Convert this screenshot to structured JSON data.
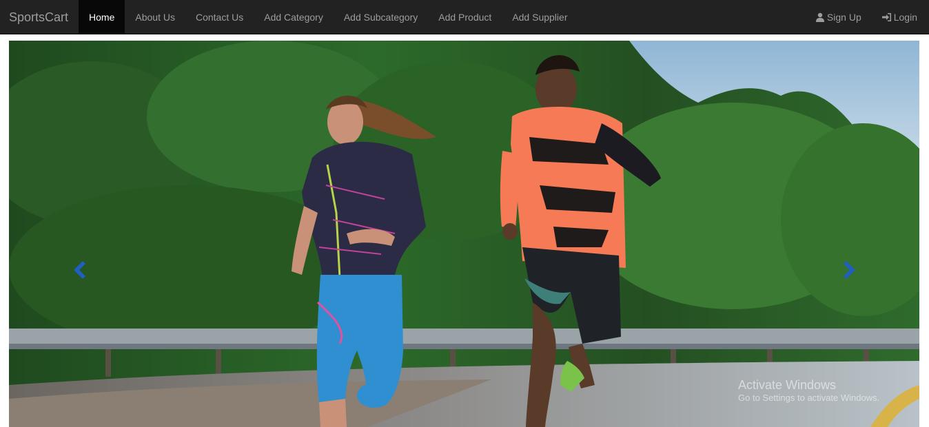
{
  "navbar": {
    "brand": "SportsCart",
    "links": [
      {
        "label": "Home",
        "active": true
      },
      {
        "label": "About Us"
      },
      {
        "label": "Contact Us"
      },
      {
        "label": "Add Category"
      },
      {
        "label": "Add Subcategory"
      },
      {
        "label": "Add Product"
      },
      {
        "label": "Add Supplier"
      }
    ],
    "right_links": [
      {
        "label": "Sign Up",
        "icon": "user-icon"
      },
      {
        "label": "Login",
        "icon": "log-in-icon"
      }
    ]
  },
  "carousel": {
    "slide": {
      "alt": "two runners on a road",
      "icon": "runners-photo"
    },
    "prev_icon": "chevron-left-icon",
    "next_icon": "chevron-right-icon",
    "control_color": "#1f5fbf"
  },
  "watermark": {
    "title": "Activate Windows",
    "subtitle": "Go to Settings to activate Windows."
  },
  "colors": {
    "navbar_bg": "#222222",
    "nav_text": "#9d9d9d",
    "active_bg": "#080808",
    "active_text": "#ffffff"
  }
}
